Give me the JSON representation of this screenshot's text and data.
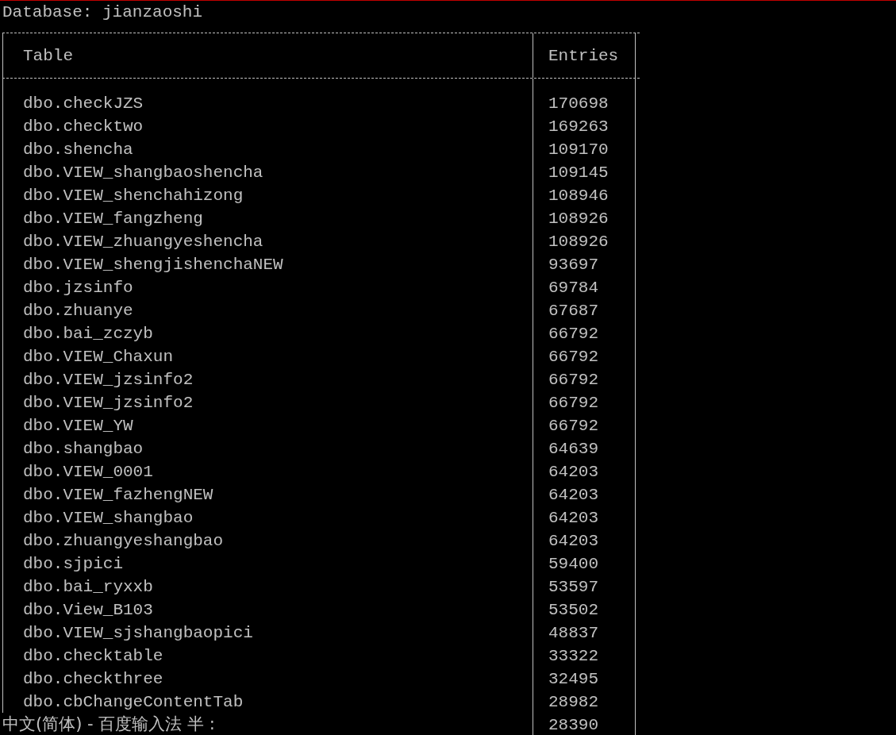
{
  "database_line": "Database: jianzaoshi",
  "columns": [
    "Table",
    "Entries"
  ],
  "rows": [
    {
      "table": "dbo.checkJZS",
      "entries": "170698"
    },
    {
      "table": "dbo.checktwo",
      "entries": "169263"
    },
    {
      "table": "dbo.shencha",
      "entries": "109170"
    },
    {
      "table": "dbo.VIEW_shangbaoshencha",
      "entries": "109145"
    },
    {
      "table": "dbo.VIEW_shenchahizong",
      "entries": "108946"
    },
    {
      "table": "dbo.VIEW_fangzheng",
      "entries": "108926"
    },
    {
      "table": "dbo.VIEW_zhuangyeshencha",
      "entries": "108926"
    },
    {
      "table": "dbo.VIEW_shengjishenchaNEW",
      "entries": "93697"
    },
    {
      "table": "dbo.jzsinfo",
      "entries": "69784"
    },
    {
      "table": "dbo.zhuanye",
      "entries": "67687"
    },
    {
      "table": "dbo.bai_zczyb",
      "entries": "66792"
    },
    {
      "table": "dbo.VIEW_Chaxun",
      "entries": "66792"
    },
    {
      "table": "dbo.VIEW_jzsinfo2",
      "entries": "66792"
    },
    {
      "table": "dbo.VIEW_jzsinfo2",
      "entries": "66792"
    },
    {
      "table": "dbo.VIEW_YW",
      "entries": "66792"
    },
    {
      "table": "dbo.shangbao",
      "entries": "64639"
    },
    {
      "table": "dbo.VIEW_0001",
      "entries": "64203"
    },
    {
      "table": "dbo.VIEW_fazhengNEW",
      "entries": "64203"
    },
    {
      "table": "dbo.VIEW_shangbao",
      "entries": "64203"
    },
    {
      "table": "dbo.zhuangyeshangbao",
      "entries": "64203"
    },
    {
      "table": "dbo.sjpici",
      "entries": "59400"
    },
    {
      "table": "dbo.bai_ryxxb",
      "entries": "53597"
    },
    {
      "table": "dbo.View_B103",
      "entries": "53502"
    },
    {
      "table": "dbo.VIEW_sjshangbaopici",
      "entries": "48837"
    },
    {
      "table": "dbo.checktable",
      "entries": "33322"
    },
    {
      "table": "dbo.checkthree",
      "entries": "32495"
    },
    {
      "table": "dbo.cbChangeContentTab",
      "entries": "28982"
    },
    {
      "entries": "28390"
    }
  ],
  "input_method_status": "中文(简体) - 百度输入法 半 :"
}
